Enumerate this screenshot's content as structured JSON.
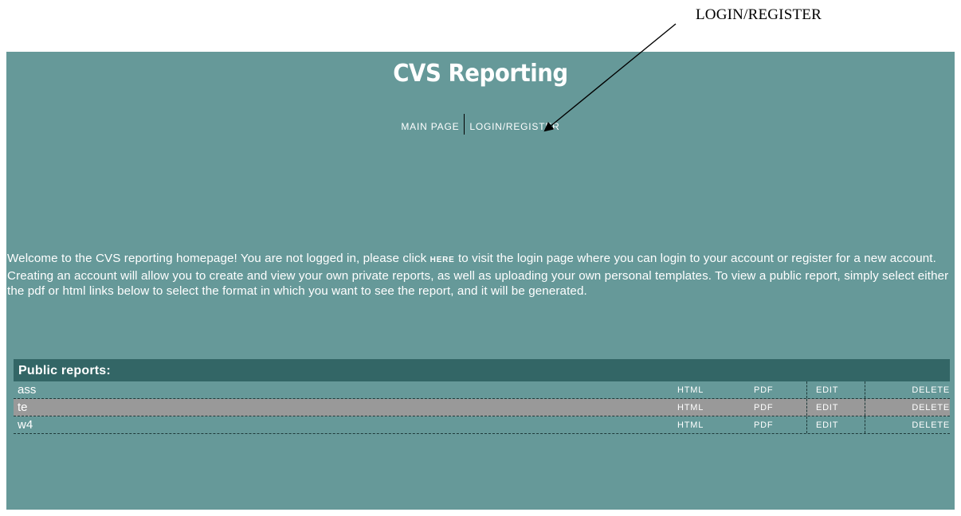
{
  "annotation": {
    "label": "LOGIN/REGISTER"
  },
  "site": {
    "title": "CVS Reporting"
  },
  "nav": {
    "main_page": "MAIN PAGE",
    "login_register": "LOGIN/REGISTER"
  },
  "welcome": {
    "before_link": "Welcome to the CVS reporting homepage! You are not logged in, please click ",
    "link": "HERE",
    "after_link": " to visit the login page where you can login to your account or register for a new account. Creating an account will allow you to create and view your own private reports, as well as uploading your own personal templates. To view a public report, simply select either the pdf or html links below to select the format in which you want to see the report, and it will be generated."
  },
  "public_reports": {
    "heading": "Public reports:",
    "rows": [
      {
        "name": "ass",
        "html": "HTML",
        "pdf": "PDF",
        "edit": "EDIT",
        "delete": "DELETE"
      },
      {
        "name": "te",
        "html": "HTML",
        "pdf": "PDF",
        "edit": "EDIT",
        "delete": "DELETE"
      },
      {
        "name": "w4",
        "html": "HTML",
        "pdf": "PDF",
        "edit": "EDIT",
        "delete": "DELETE"
      }
    ]
  },
  "colors": {
    "panel_background": "#669999",
    "reports_header": "#336666",
    "alternate_row": "#999999"
  }
}
